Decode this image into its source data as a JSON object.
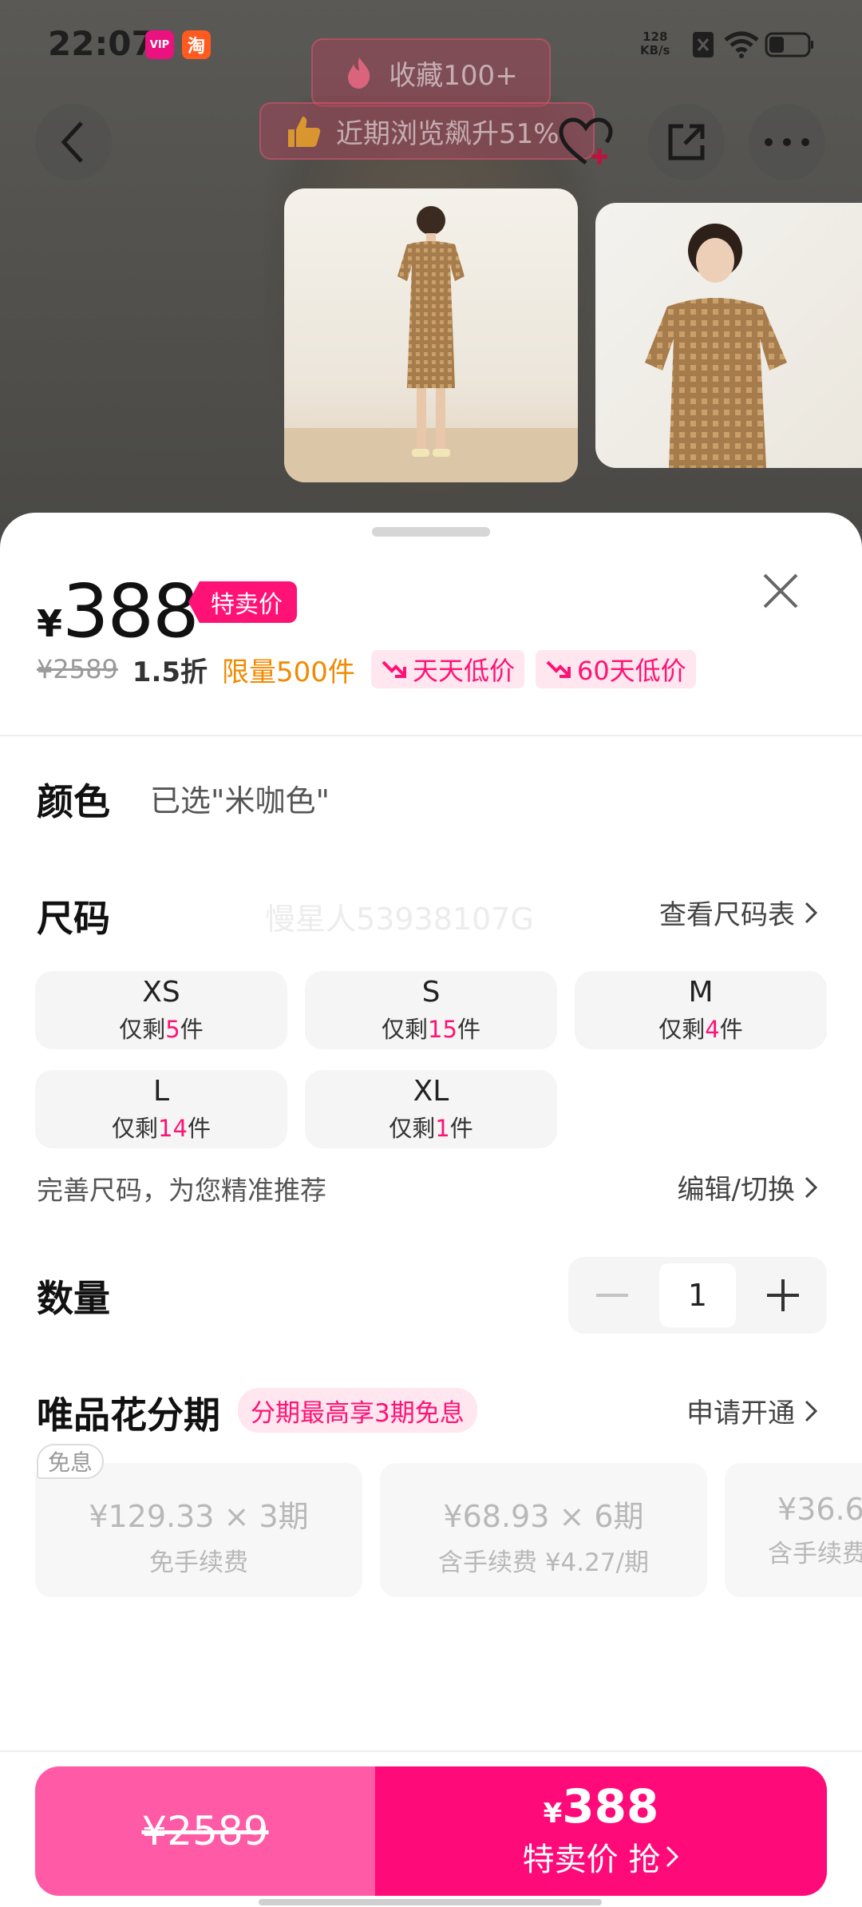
{
  "status_bar": {
    "time": "22:07",
    "vip_app": "唯品会",
    "taobao_app": "淘",
    "net_speed_value": "128",
    "net_speed_unit": "KB/s"
  },
  "toasts": {
    "favorites": "收藏100+",
    "views": "近期浏览飙升51%"
  },
  "price": {
    "currency": "¥",
    "current": "388",
    "special_tag": "特卖价",
    "original": "¥2589",
    "discount": "1.5折",
    "limit": "限量500件",
    "low_tags": [
      "天天低价",
      "60天低价"
    ]
  },
  "color": {
    "label": "颜色",
    "selected": "已选\"米咖色\""
  },
  "size": {
    "label": "尺码",
    "watermark": "慢星人53938107G",
    "chart_link": "查看尺码表",
    "options": [
      {
        "size": "XS",
        "prefix": "仅剩",
        "count": "5",
        "suffix": "件"
      },
      {
        "size": "S",
        "prefix": "仅剩",
        "count": "15",
        "suffix": "件"
      },
      {
        "size": "M",
        "prefix": "仅剩",
        "count": "4",
        "suffix": "件"
      },
      {
        "size": "L",
        "prefix": "仅剩",
        "count": "14",
        "suffix": "件"
      },
      {
        "size": "XL",
        "prefix": "仅剩",
        "count": "1",
        "suffix": "件"
      }
    ],
    "recommend_text": "完善尺码，为您精准推荐",
    "edit_link": "编辑/切换"
  },
  "quantity": {
    "label": "数量",
    "value": "1"
  },
  "installment": {
    "label": "唯品花分期",
    "promo": "分期最高享3期免息",
    "apply_link": "申请开通",
    "free_badge": "免息",
    "plans": [
      {
        "amount": "¥129.33 × 3期",
        "fee": "免手续费"
      },
      {
        "amount": "¥68.93 × 6期",
        "fee": "含手续费 ¥4.27/期"
      },
      {
        "amount": "¥36.6",
        "fee": "含手续费"
      }
    ]
  },
  "buy_bar": {
    "original_price": "¥2589",
    "currency": "¥",
    "price": "388",
    "action": "特卖价 抢"
  },
  "colors": {
    "brand_pink": "#ff1275",
    "orange": "#f08a00"
  }
}
